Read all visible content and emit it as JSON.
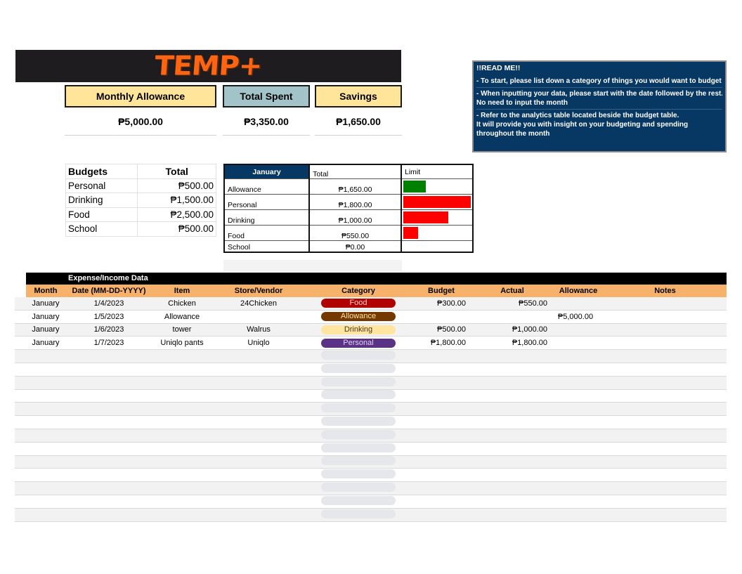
{
  "logo": {
    "text": "TEMP+",
    "color": "#ff6410"
  },
  "summary": {
    "allowance": {
      "label": "Monthly Allowance",
      "value": "₱5,000.00"
    },
    "spent": {
      "label": "Total Spent",
      "value": "₱3,350.00"
    },
    "savings": {
      "label": "Savings",
      "value": "₱1,650.00"
    }
  },
  "readme": {
    "title": "!!READ ME!!",
    "lines": [
      "- To start, please list down a category of things you would want to budget",
      "- When inputting your data, please start with the date followed by the rest.",
      " No need to input the month",
      "- Refer to the analytics table located beside the budget table.",
      "It will provide you with insight on your budgeting and spending throughout the month"
    ]
  },
  "budgets": {
    "header": {
      "name": "Budgets",
      "total": "Total"
    },
    "rows": [
      {
        "name": "Personal",
        "total": "₱500.00"
      },
      {
        "name": "Drinking",
        "total": "₱1,500.00"
      },
      {
        "name": "Food",
        "total": "₱2,500.00"
      },
      {
        "name": "School",
        "total": "₱500.00"
      }
    ]
  },
  "analytics": {
    "header": {
      "month": "January",
      "total": "Total",
      "limit": "Limit"
    },
    "rows": [
      {
        "name": "Allowance",
        "total": "₱1,650.00",
        "limit_fraction": 0.33,
        "bar_color": "#008000"
      },
      {
        "name": "Personal",
        "total": "₱1,800.00",
        "limit_fraction": 1.0,
        "bar_color": "#ff0000"
      },
      {
        "name": "Drinking",
        "total": "₱1,000.00",
        "limit_fraction": 0.67,
        "bar_color": "#ff0000"
      },
      {
        "name": "Food",
        "total": "₱550.00",
        "limit_fraction": 0.22,
        "bar_color": "#ff0000"
      },
      {
        "name": "School",
        "total": "₱0.00",
        "limit_fraction": 0,
        "bar_color": "#ff0000"
      }
    ]
  },
  "expenses": {
    "title": "Expense/Income Data",
    "columns": [
      "Month",
      "Date (MM-DD-YYYY)",
      "Item",
      "Store/Vendor",
      "Category",
      "Budget",
      "Actual",
      "Allowance",
      "Notes"
    ],
    "rows": [
      {
        "month": "January",
        "date": "1/4/2023",
        "item": "Chicken",
        "store": "24Chicken",
        "category": "Food",
        "cat_bg": "#b10202",
        "cat_fg": "#ffcfc9",
        "budget": "₱300.00",
        "actual": "₱550.00",
        "allowance": "",
        "notes": ""
      },
      {
        "month": "January",
        "date": "1/5/2023",
        "item": "Allowance",
        "store": "",
        "category": "Allowance",
        "cat_bg": "#753800",
        "cat_fg": "#ffe5a0",
        "budget": "",
        "actual": "",
        "allowance": "₱5,000.00",
        "notes": ""
      },
      {
        "month": "January",
        "date": "1/6/2023",
        "item": "tower",
        "store": "Walrus",
        "category": "Drinking",
        "cat_bg": "#ffe5a0",
        "cat_fg": "#473821",
        "budget": "₱500.00",
        "actual": "₱1,000.00",
        "allowance": "",
        "notes": ""
      },
      {
        "month": "January",
        "date": "1/7/2023",
        "item": "Uniqlo pants",
        "store": "Uniqlo",
        "category": "Personal",
        "cat_bg": "#5a3286",
        "cat_fg": "#e6cff2",
        "budget": "₱1,800.00",
        "actual": "₱1,800.00",
        "allowance": "",
        "notes": ""
      }
    ],
    "empty_row_count": 13
  }
}
